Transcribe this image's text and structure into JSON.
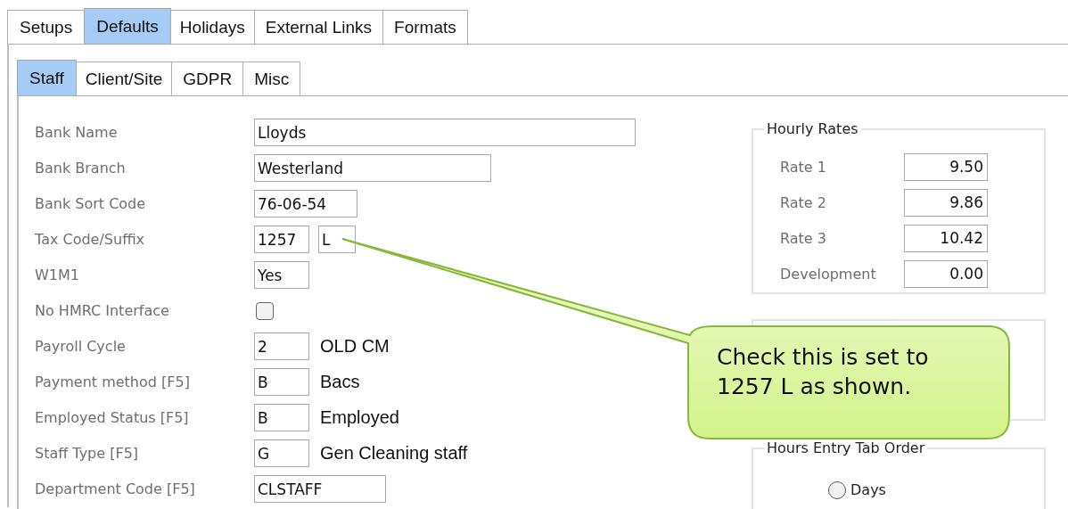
{
  "tabs": [
    {
      "label": "Setups",
      "selected": false
    },
    {
      "label": "Defaults",
      "selected": true
    },
    {
      "label": "Holidays",
      "selected": false
    },
    {
      "label": "External Links",
      "selected": false
    },
    {
      "label": "Formats",
      "selected": false
    }
  ],
  "sub_tabs": [
    {
      "label": "Staff",
      "selected": true
    },
    {
      "label": "Client/Site",
      "selected": false
    },
    {
      "label": "GDPR",
      "selected": false
    },
    {
      "label": "Misc",
      "selected": false
    }
  ],
  "form": [
    {
      "kind": "text",
      "label": "Bank Name",
      "value": "Lloyds"
    },
    {
      "kind": "text",
      "label": "Bank Branch",
      "value": "Westerland"
    },
    {
      "kind": "text",
      "label": "Bank Sort Code",
      "value": "76-06-54"
    },
    {
      "kind": "pair",
      "label": "Tax Code/Suffix",
      "value": "1257",
      "suffix": "L"
    },
    {
      "kind": "text",
      "label": "W1M1",
      "value": "Yes"
    },
    {
      "kind": "check",
      "label": "No HMRC Interface",
      "checked": false
    },
    {
      "kind": "code",
      "label": "Payroll Cycle",
      "value": "2",
      "description": "OLD CM"
    },
    {
      "kind": "code",
      "label": "Payment method [F5]",
      "value": "B",
      "description": "Bacs"
    },
    {
      "kind": "code",
      "label": "Employed Status [F5]",
      "value": "B",
      "description": "Employed"
    },
    {
      "kind": "code",
      "label": "Staff Type [F5]",
      "value": "G",
      "description": "Gen Cleaning staff"
    },
    {
      "kind": "text",
      "label": "Department Code [F5]",
      "value": "CLSTAFF"
    }
  ],
  "hourly_rates": {
    "title": "Hourly Rates",
    "rows": [
      {
        "label": "Rate 1",
        "value": "9.50"
      },
      {
        "label": "Rate 2",
        "value": "9.86"
      },
      {
        "label": "Rate 3",
        "value": "10.42"
      },
      {
        "label": "Development",
        "value": "0.00"
      }
    ]
  },
  "hours_entry_tab_order": {
    "title": "Hours Entry Tab Order",
    "options": [
      {
        "label": "Days",
        "selected": false
      }
    ]
  },
  "callout": {
    "text": "Check this is set to 1257 L as shown."
  }
}
